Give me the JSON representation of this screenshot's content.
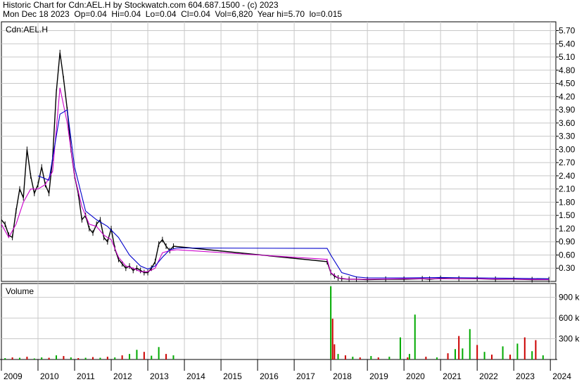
{
  "header": {
    "line1": "Historic Chart for Cdn:AEL.H by Stockwatch.com 604.687.1500 - (c) 2023",
    "line2": "Mon Dec 18 2023  Op=0.04  Hi=0.04  Lo=0.04  Cl=0.04  Vol=6,820  Year hi=5.70  lo=0.015"
  },
  "chart_data": [
    {
      "type": "line",
      "title": "Cdn:AEL.H",
      "ylim": [
        0,
        5.9
      ],
      "yticks": [
        "5.70",
        "5.40",
        "5.10",
        "4.80",
        "4.50",
        "4.20",
        "3.90",
        "3.60",
        "3.30",
        "3.00",
        "2.70",
        "2.40",
        "2.10",
        "1.80",
        "1.50",
        "1.20",
        "0.90",
        "0.60",
        "0.30"
      ],
      "xticks": [
        "2009",
        "2010",
        "2011",
        "2012",
        "2013",
        "2014",
        "2015",
        "2016",
        "2017",
        "2018",
        "2019",
        "2020",
        "2021",
        "2022",
        "2023",
        "2024"
      ],
      "grid": true,
      "series": [
        {
          "kind": "price",
          "x": [
            2009.0,
            2009.1,
            2009.2,
            2009.3,
            2009.4,
            2009.5,
            2009.6,
            2009.7,
            2009.8,
            2009.9,
            2010.0,
            2010.1,
            2010.2,
            2010.3,
            2010.4,
            2010.5,
            2010.6,
            2010.7,
            2010.8,
            2010.9,
            2011.0,
            2011.1,
            2011.2,
            2011.3,
            2011.4,
            2011.5,
            2011.6,
            2011.7,
            2011.8,
            2011.9,
            2012.0,
            2012.1,
            2012.2,
            2012.3,
            2012.4,
            2012.5,
            2012.6,
            2012.7,
            2012.8,
            2012.9,
            2013.0,
            2013.1,
            2013.2,
            2013.3,
            2013.4,
            2013.5,
            2013.6,
            2013.7,
            2017.9,
            2018.0,
            2018.1,
            2018.2,
            2018.3,
            2018.5,
            2018.7,
            2019.0,
            2019.5,
            2020.0,
            2020.5,
            2020.7,
            2021.0,
            2021.5,
            2022.0,
            2022.5,
            2023.0,
            2023.5,
            2023.96
          ],
          "values": [
            1.4,
            1.3,
            1.05,
            1.0,
            1.6,
            2.1,
            1.9,
            3.0,
            2.4,
            2.0,
            2.2,
            2.6,
            2.2,
            2.0,
            2.8,
            4.3,
            5.2,
            4.6,
            3.9,
            3.0,
            2.4,
            2.0,
            1.4,
            1.5,
            1.2,
            1.1,
            1.3,
            1.4,
            1.0,
            0.9,
            1.2,
            0.75,
            0.5,
            0.4,
            0.3,
            0.35,
            0.25,
            0.3,
            0.25,
            0.2,
            0.2,
            0.3,
            0.45,
            0.85,
            0.95,
            0.8,
            0.7,
            0.8,
            0.45,
            0.2,
            0.12,
            0.08,
            0.06,
            0.05,
            0.05,
            0.04,
            0.05,
            0.05,
            0.06,
            0.05,
            0.07,
            0.06,
            0.06,
            0.05,
            0.05,
            0.04,
            0.04
          ],
          "color": "#000000"
        },
        {
          "kind": "ma-short",
          "x": [
            2009.0,
            2009.2,
            2009.4,
            2009.6,
            2009.8,
            2010.0,
            2010.2,
            2010.4,
            2010.6,
            2010.8,
            2011.0,
            2011.2,
            2011.4,
            2011.6,
            2011.8,
            2012.0,
            2012.2,
            2012.4,
            2012.6,
            2012.8,
            2013.0,
            2013.2,
            2013.4,
            2013.6,
            2013.8,
            2017.9,
            2018.0,
            2018.2,
            2018.5,
            2019.0,
            2020.0,
            2021.0,
            2022.0,
            2023.0,
            2023.96
          ],
          "values": [
            1.3,
            1.0,
            1.3,
            1.8,
            2.1,
            2.1,
            2.2,
            2.5,
            4.4,
            3.6,
            2.4,
            1.7,
            1.3,
            1.25,
            1.05,
            0.95,
            0.55,
            0.35,
            0.3,
            0.22,
            0.22,
            0.3,
            0.65,
            0.7,
            0.72,
            0.5,
            0.2,
            0.08,
            0.05,
            0.05,
            0.06,
            0.06,
            0.06,
            0.05,
            0.04
          ],
          "color": "#cc00cc"
        },
        {
          "kind": "ma-long",
          "x": [
            2010.0,
            2010.3,
            2010.6,
            2010.8,
            2011.0,
            2011.3,
            2011.6,
            2011.9,
            2012.2,
            2012.5,
            2012.8,
            2013.0,
            2013.2,
            2013.4,
            2013.6,
            2013.8,
            2017.9,
            2018.0,
            2018.3,
            2018.7,
            2019.0,
            2020.0,
            2021.0,
            2022.0,
            2023.0,
            2023.96
          ],
          "values": [
            2.4,
            2.3,
            3.8,
            3.9,
            2.6,
            1.6,
            1.4,
            1.25,
            1.0,
            0.6,
            0.35,
            0.28,
            0.35,
            0.55,
            0.72,
            0.76,
            0.75,
            0.6,
            0.2,
            0.1,
            0.08,
            0.08,
            0.09,
            0.08,
            0.07,
            0.06
          ],
          "color": "#0000cc"
        }
      ]
    },
    {
      "type": "bar",
      "title": "Volume",
      "ylim": [
        0,
        1100
      ],
      "yticks": [
        "900 k",
        "600 k",
        "300 k"
      ],
      "x": [
        2009.1,
        2009.3,
        2009.5,
        2009.7,
        2009.9,
        2010.1,
        2010.3,
        2010.5,
        2010.7,
        2010.9,
        2011.1,
        2011.3,
        2011.5,
        2011.7,
        2011.9,
        2012.1,
        2012.3,
        2012.5,
        2012.7,
        2012.9,
        2013.1,
        2013.3,
        2013.5,
        2013.7,
        2018.0,
        2018.05,
        2018.1,
        2018.2,
        2018.4,
        2018.6,
        2018.8,
        2019.1,
        2019.3,
        2019.6,
        2019.9,
        2020.1,
        2020.15,
        2020.3,
        2020.6,
        2020.9,
        2021.2,
        2021.4,
        2021.5,
        2021.6,
        2021.8,
        2022.0,
        2022.2,
        2022.4,
        2022.7,
        2022.9,
        2023.1,
        2023.3,
        2023.5,
        2023.6,
        2023.8
      ],
      "values": [
        20,
        30,
        25,
        40,
        15,
        30,
        25,
        60,
        50,
        30,
        20,
        25,
        35,
        25,
        40,
        30,
        60,
        80,
        140,
        110,
        55,
        180,
        80,
        60,
        1060,
        590,
        220,
        80,
        60,
        40,
        30,
        50,
        30,
        40,
        320,
        30,
        80,
        650,
        40,
        30,
        90,
        150,
        340,
        160,
        440,
        210,
        110,
        70,
        190,
        70,
        230,
        320,
        120,
        280,
        60
      ],
      "updown": [
        "up",
        "down",
        "up",
        "down",
        "up",
        "up",
        "down",
        "up",
        "down",
        "up",
        "down",
        "up",
        "down",
        "up",
        "down",
        "up",
        "down",
        "up",
        "up",
        "down",
        "up",
        "up",
        "down",
        "up",
        "up",
        "down",
        "down",
        "up",
        "down",
        "up",
        "down",
        "up",
        "down",
        "up",
        "up",
        "down",
        "up",
        "up",
        "down",
        "up",
        "down",
        "up",
        "down",
        "up",
        "up",
        "down",
        "up",
        "down",
        "up",
        "down",
        "up",
        "down",
        "up",
        "down",
        "up"
      ],
      "colors": {
        "up": "#00aa00",
        "down": "#cc0000",
        "flat": "#999999"
      }
    }
  ]
}
